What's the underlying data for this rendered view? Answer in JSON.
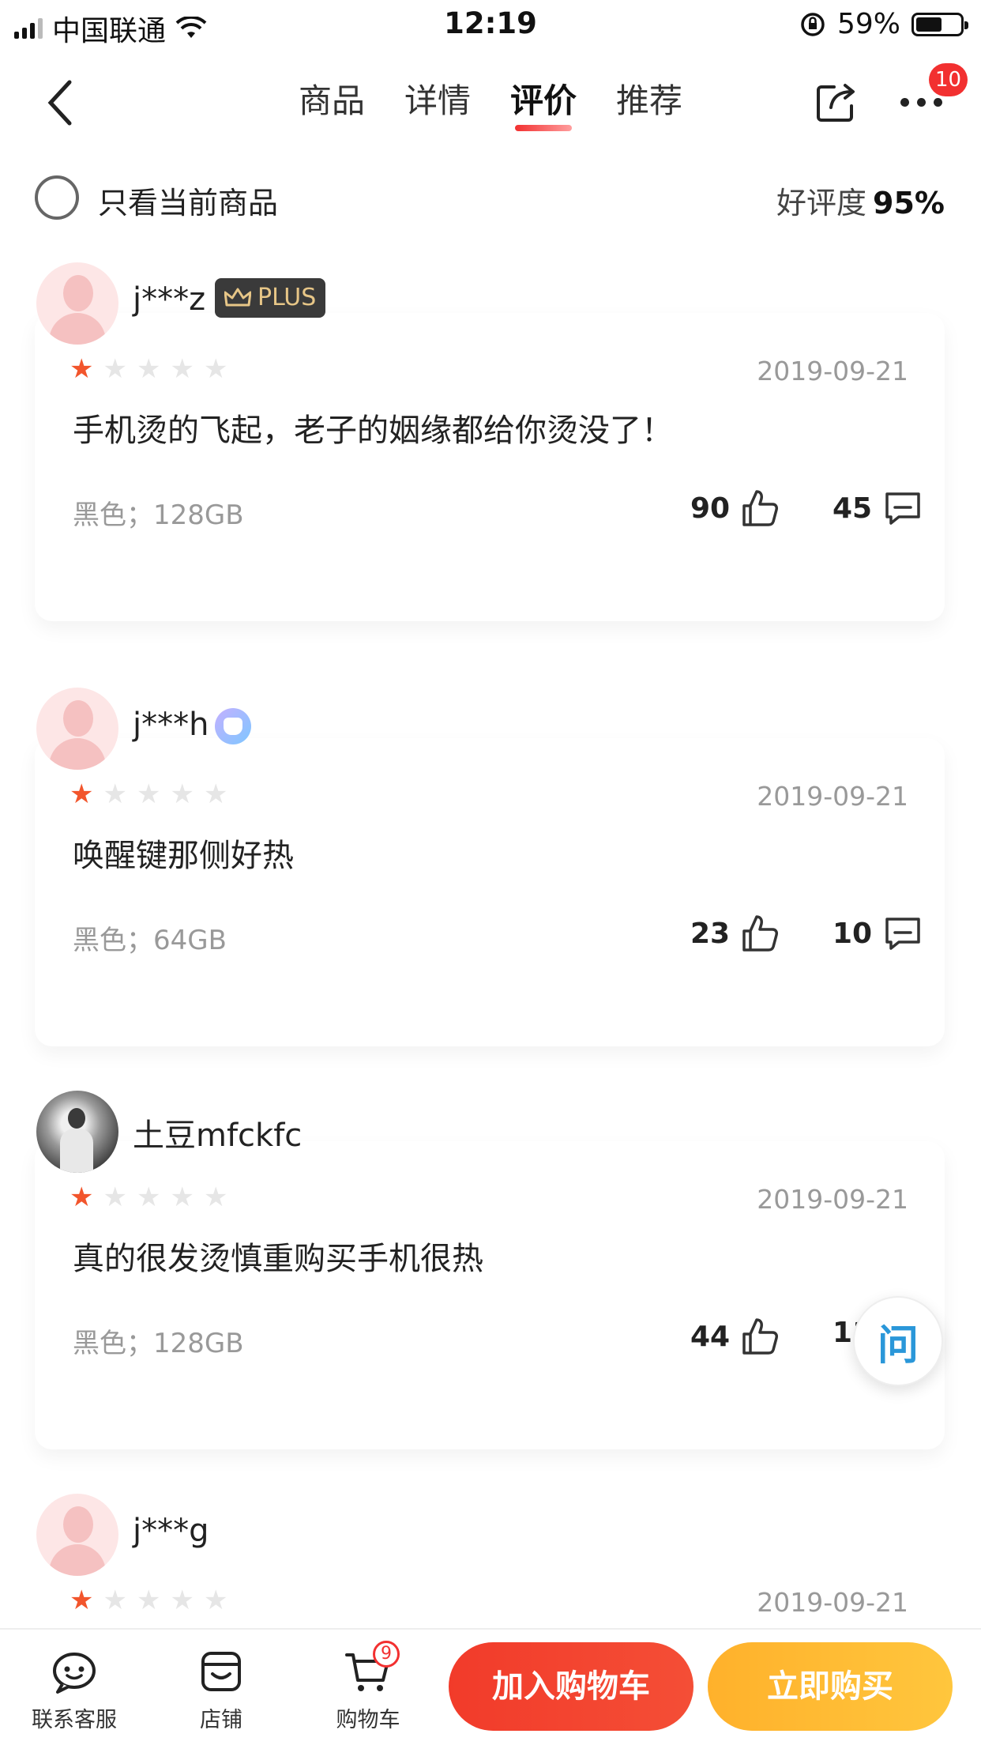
{
  "status_bar": {
    "carrier": "中国联通",
    "time": "12:19",
    "battery": "59%"
  },
  "nav": {
    "tabs": [
      {
        "label": "商品",
        "active": false
      },
      {
        "label": "详情",
        "active": false
      },
      {
        "label": "评价",
        "active": true
      },
      {
        "label": "推荐",
        "active": false
      }
    ],
    "more_badge": "10"
  },
  "filter": {
    "label": "只看当前商品",
    "rate_label": "好评度",
    "rate_value": "95%"
  },
  "reviews": [
    {
      "user": "j***z",
      "badge": "PLUS",
      "stars": 1,
      "date": "2019-09-21",
      "content": "手机烫的飞起，老子的姻缘都给你烫没了！",
      "spec": "黑色；128GB",
      "likes": "90",
      "comments": "45"
    },
    {
      "user": "j***h",
      "stars": 1,
      "date": "2019-09-21",
      "content": "唤醒键那侧好热",
      "spec": "黑色；64GB",
      "likes": "23",
      "comments": "10"
    },
    {
      "user": "土豆mfckfc",
      "stars": 1,
      "date": "2019-09-21",
      "content": "真的很发烫慎重购买手机很热",
      "spec": "黑色；128GB",
      "likes": "44",
      "comments": "11"
    },
    {
      "user": "j***g",
      "stars": 1,
      "date": "2019-09-21"
    }
  ],
  "floating": {
    "qa_label": "问"
  },
  "bottom_bar": {
    "service": "联系客服",
    "shop": "店铺",
    "cart": "购物车",
    "cart_badge": "9",
    "add_to_cart": "加入购物车",
    "buy_now": "立即购买"
  },
  "colors": {
    "accent": "#f23030",
    "star": "#f2552c",
    "buy": "#ffb12b"
  }
}
